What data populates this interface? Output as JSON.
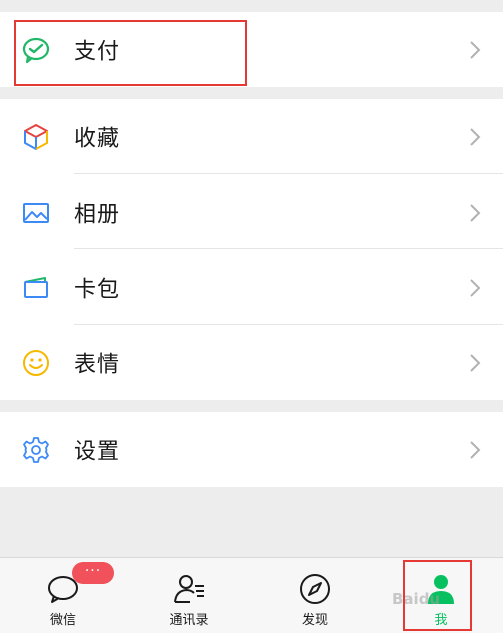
{
  "menu": {
    "pay": {
      "label": "支付",
      "icon": "wechat-pay-icon"
    },
    "favorites": {
      "label": "收藏",
      "icon": "cube-icon"
    },
    "album": {
      "label": "相册",
      "icon": "image-icon"
    },
    "cards": {
      "label": "卡包",
      "icon": "card-wallet-icon"
    },
    "stickers": {
      "label": "表情",
      "icon": "smiley-icon"
    },
    "settings": {
      "label": "设置",
      "icon": "gear-icon"
    }
  },
  "tabbar": {
    "chats": {
      "label": "微信",
      "badge": "···",
      "icon": "chat-bubble-icon"
    },
    "contacts": {
      "label": "通讯录",
      "icon": "contacts-icon"
    },
    "discover": {
      "label": "发现",
      "icon": "compass-icon"
    },
    "me": {
      "label": "我",
      "icon": "person-icon"
    }
  },
  "watermark": "Baidu",
  "colors": {
    "accent": "#07c160",
    "highlight_box": "#e53935",
    "badge": "#f1515a"
  }
}
